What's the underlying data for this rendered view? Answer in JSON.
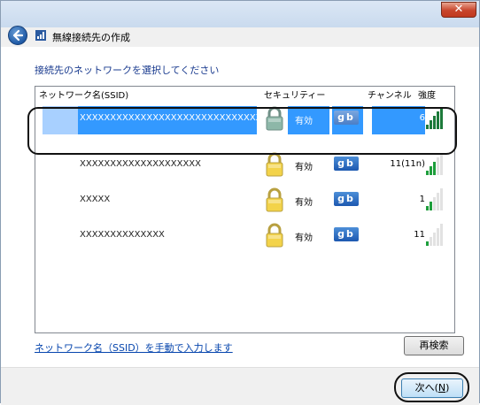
{
  "window": {
    "title": "無線接続先の作成",
    "close_glyph": "✕"
  },
  "instruction": "接続先のネットワークを選択してください",
  "columns": {
    "ssid": "ネットワーク名(SSID)",
    "security": "セキュリティー",
    "channel": "チャンネル",
    "strength": "強度"
  },
  "networks": [
    {
      "ssid": "XXXXXXXXXXXXXXXXXXXXXXXXXXXXXX",
      "security": "有効",
      "mode": "gb",
      "channel": "6",
      "strength_bars": 5,
      "selected": true
    },
    {
      "ssid": "XXXXXXXXXXXXXXXXXXXX",
      "security": "有効",
      "mode": "gb",
      "channel": "11(11n)",
      "strength_bars": 3,
      "selected": false
    },
    {
      "ssid": "XXXXX",
      "security": "有効",
      "mode": "gb",
      "channel": "1",
      "strength_bars": 2,
      "selected": false
    },
    {
      "ssid": "XXXXXXXXXXXXXX",
      "security": "有効",
      "mode": "gb",
      "channel": "11",
      "strength_bars": 1,
      "selected": false
    }
  ],
  "manual_link": "ネットワーク名（SSID）を手動で入力します",
  "rescan_button": "再検索",
  "next_button": {
    "label": "次へ(",
    "key": "N",
    "suffix": ")"
  },
  "icons": {
    "back": "back-arrow-icon",
    "wireless": "wireless-network-icon",
    "lock": "lock-icon",
    "mode": "gb-icon",
    "signal": "signal-strength-icon"
  },
  "colors": {
    "selection": "#3399ff",
    "link": "#0645ad",
    "instruction": "#1a3b8f",
    "signal_on": "#1e9e3c"
  }
}
